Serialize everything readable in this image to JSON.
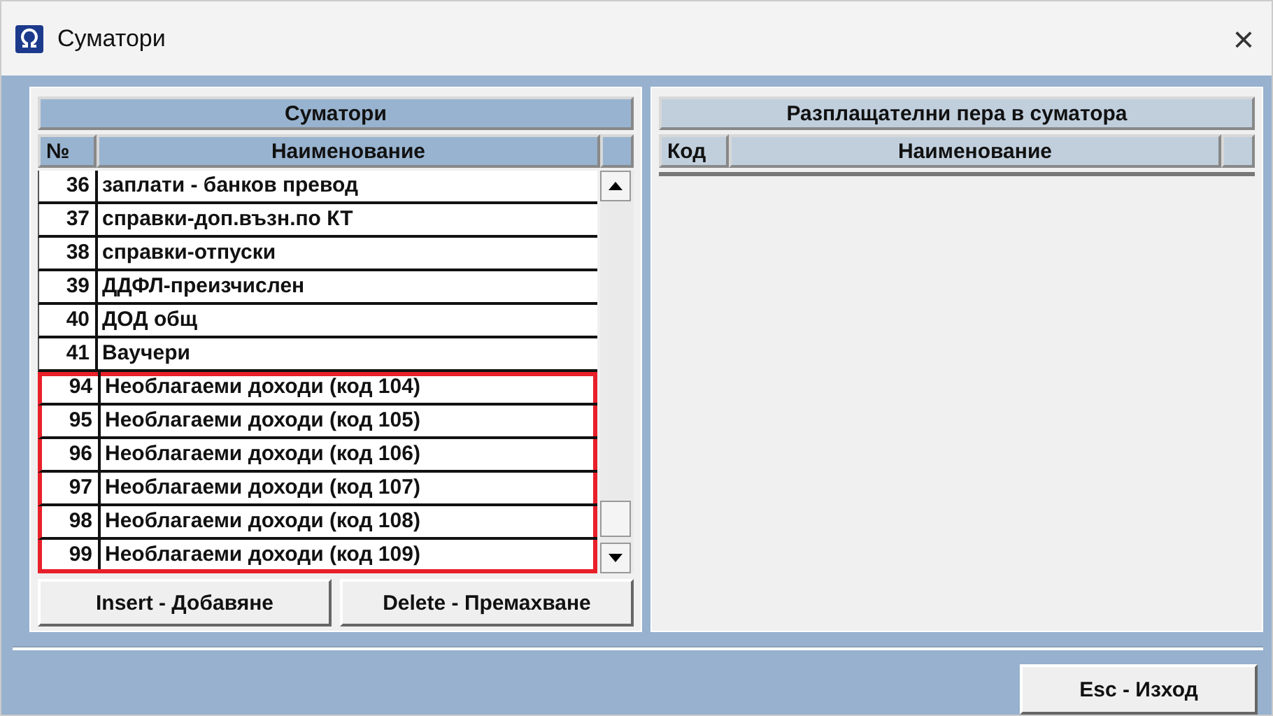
{
  "window": {
    "title": "Суматори",
    "close": "×"
  },
  "left_panel": {
    "title": "Суматори",
    "columns": [
      "№",
      "Наименование"
    ],
    "rows": [
      {
        "no": "36",
        "name": "заплати - банков превод",
        "highlighted": false
      },
      {
        "no": "37",
        "name": "справки-доп.възн.по КТ",
        "highlighted": false
      },
      {
        "no": "38",
        "name": "справки-отпуски",
        "highlighted": false
      },
      {
        "no": "39",
        "name": "ДДФЛ-преизчислен",
        "highlighted": false
      },
      {
        "no": "40",
        "name": "ДОД общ",
        "highlighted": false
      },
      {
        "no": "41",
        "name": "Ваучери",
        "highlighted": false
      },
      {
        "no": "94",
        "name": "Необлагаеми доходи (код 104)",
        "highlighted": true
      },
      {
        "no": "95",
        "name": "Необлагаеми доходи (код 105)",
        "highlighted": true
      },
      {
        "no": "96",
        "name": "Необлагаеми доходи (код 106)",
        "highlighted": true
      },
      {
        "no": "97",
        "name": "Необлагаеми доходи (код 107)",
        "highlighted": true
      },
      {
        "no": "98",
        "name": "Необлагаеми доходи (код 108)",
        "highlighted": true
      },
      {
        "no": "99",
        "name": "Необлагаеми доходи (код 109)",
        "highlighted": true
      }
    ],
    "buttons": [
      "Insert - Добавяне",
      "Delete - Премахване"
    ]
  },
  "right_panel": {
    "title": "Разплащателни пера в суматора",
    "columns": [
      "Код",
      "Наименование"
    ]
  },
  "footer_buttons": [
    "Esc - Изход"
  ]
}
